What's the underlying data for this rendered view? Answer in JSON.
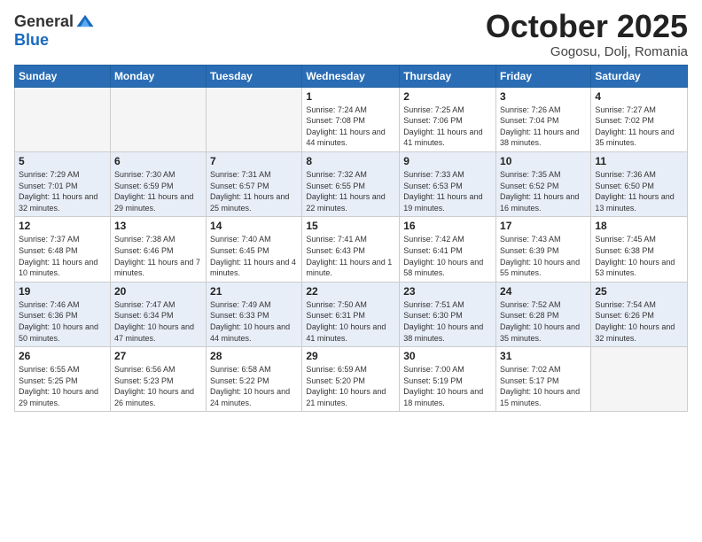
{
  "header": {
    "logo_general": "General",
    "logo_blue": "Blue",
    "month_title": "October 2025",
    "subtitle": "Gogosu, Dolj, Romania"
  },
  "weekdays": [
    "Sunday",
    "Monday",
    "Tuesday",
    "Wednesday",
    "Thursday",
    "Friday",
    "Saturday"
  ],
  "weeks": [
    [
      {
        "day": "",
        "info": ""
      },
      {
        "day": "",
        "info": ""
      },
      {
        "day": "",
        "info": ""
      },
      {
        "day": "1",
        "info": "Sunrise: 7:24 AM\nSunset: 7:08 PM\nDaylight: 11 hours and 44 minutes."
      },
      {
        "day": "2",
        "info": "Sunrise: 7:25 AM\nSunset: 7:06 PM\nDaylight: 11 hours and 41 minutes."
      },
      {
        "day": "3",
        "info": "Sunrise: 7:26 AM\nSunset: 7:04 PM\nDaylight: 11 hours and 38 minutes."
      },
      {
        "day": "4",
        "info": "Sunrise: 7:27 AM\nSunset: 7:02 PM\nDaylight: 11 hours and 35 minutes."
      }
    ],
    [
      {
        "day": "5",
        "info": "Sunrise: 7:29 AM\nSunset: 7:01 PM\nDaylight: 11 hours and 32 minutes."
      },
      {
        "day": "6",
        "info": "Sunrise: 7:30 AM\nSunset: 6:59 PM\nDaylight: 11 hours and 29 minutes."
      },
      {
        "day": "7",
        "info": "Sunrise: 7:31 AM\nSunset: 6:57 PM\nDaylight: 11 hours and 25 minutes."
      },
      {
        "day": "8",
        "info": "Sunrise: 7:32 AM\nSunset: 6:55 PM\nDaylight: 11 hours and 22 minutes."
      },
      {
        "day": "9",
        "info": "Sunrise: 7:33 AM\nSunset: 6:53 PM\nDaylight: 11 hours and 19 minutes."
      },
      {
        "day": "10",
        "info": "Sunrise: 7:35 AM\nSunset: 6:52 PM\nDaylight: 11 hours and 16 minutes."
      },
      {
        "day": "11",
        "info": "Sunrise: 7:36 AM\nSunset: 6:50 PM\nDaylight: 11 hours and 13 minutes."
      }
    ],
    [
      {
        "day": "12",
        "info": "Sunrise: 7:37 AM\nSunset: 6:48 PM\nDaylight: 11 hours and 10 minutes."
      },
      {
        "day": "13",
        "info": "Sunrise: 7:38 AM\nSunset: 6:46 PM\nDaylight: 11 hours and 7 minutes."
      },
      {
        "day": "14",
        "info": "Sunrise: 7:40 AM\nSunset: 6:45 PM\nDaylight: 11 hours and 4 minutes."
      },
      {
        "day": "15",
        "info": "Sunrise: 7:41 AM\nSunset: 6:43 PM\nDaylight: 11 hours and 1 minute."
      },
      {
        "day": "16",
        "info": "Sunrise: 7:42 AM\nSunset: 6:41 PM\nDaylight: 10 hours and 58 minutes."
      },
      {
        "day": "17",
        "info": "Sunrise: 7:43 AM\nSunset: 6:39 PM\nDaylight: 10 hours and 55 minutes."
      },
      {
        "day": "18",
        "info": "Sunrise: 7:45 AM\nSunset: 6:38 PM\nDaylight: 10 hours and 53 minutes."
      }
    ],
    [
      {
        "day": "19",
        "info": "Sunrise: 7:46 AM\nSunset: 6:36 PM\nDaylight: 10 hours and 50 minutes."
      },
      {
        "day": "20",
        "info": "Sunrise: 7:47 AM\nSunset: 6:34 PM\nDaylight: 10 hours and 47 minutes."
      },
      {
        "day": "21",
        "info": "Sunrise: 7:49 AM\nSunset: 6:33 PM\nDaylight: 10 hours and 44 minutes."
      },
      {
        "day": "22",
        "info": "Sunrise: 7:50 AM\nSunset: 6:31 PM\nDaylight: 10 hours and 41 minutes."
      },
      {
        "day": "23",
        "info": "Sunrise: 7:51 AM\nSunset: 6:30 PM\nDaylight: 10 hours and 38 minutes."
      },
      {
        "day": "24",
        "info": "Sunrise: 7:52 AM\nSunset: 6:28 PM\nDaylight: 10 hours and 35 minutes."
      },
      {
        "day": "25",
        "info": "Sunrise: 7:54 AM\nSunset: 6:26 PM\nDaylight: 10 hours and 32 minutes."
      }
    ],
    [
      {
        "day": "26",
        "info": "Sunrise: 6:55 AM\nSunset: 5:25 PM\nDaylight: 10 hours and 29 minutes."
      },
      {
        "day": "27",
        "info": "Sunrise: 6:56 AM\nSunset: 5:23 PM\nDaylight: 10 hours and 26 minutes."
      },
      {
        "day": "28",
        "info": "Sunrise: 6:58 AM\nSunset: 5:22 PM\nDaylight: 10 hours and 24 minutes."
      },
      {
        "day": "29",
        "info": "Sunrise: 6:59 AM\nSunset: 5:20 PM\nDaylight: 10 hours and 21 minutes."
      },
      {
        "day": "30",
        "info": "Sunrise: 7:00 AM\nSunset: 5:19 PM\nDaylight: 10 hours and 18 minutes."
      },
      {
        "day": "31",
        "info": "Sunrise: 7:02 AM\nSunset: 5:17 PM\nDaylight: 10 hours and 15 minutes."
      },
      {
        "day": "",
        "info": ""
      }
    ]
  ]
}
